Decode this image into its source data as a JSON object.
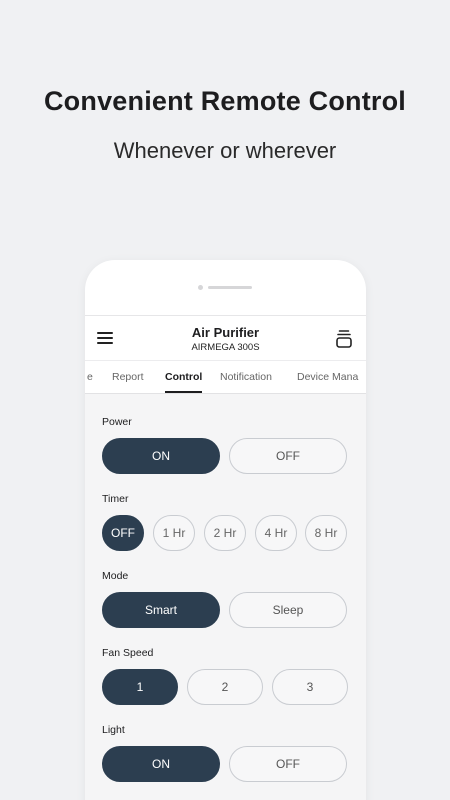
{
  "hero": {
    "title": "Convenient Remote Control",
    "subtitle": "Whenever or wherever"
  },
  "appbar": {
    "title": "Air Purifier",
    "model": "AIRMEGA 300S",
    "menu_icon": "hamburger-menu-icon",
    "device_icon": "device-stack-icon"
  },
  "tabs": [
    {
      "label": "e"
    },
    {
      "label": "Report"
    },
    {
      "label": "Control"
    },
    {
      "label": "Notification"
    },
    {
      "label": "Device Mana"
    }
  ],
  "active_tab": "Control",
  "controls": {
    "power": {
      "label": "Power",
      "options": [
        "ON",
        "OFF"
      ],
      "selected": "ON"
    },
    "timer": {
      "label": "Timer",
      "options": [
        "OFF",
        "1 Hr",
        "2 Hr",
        "4 Hr",
        "8 Hr"
      ],
      "selected": "OFF"
    },
    "mode": {
      "label": "Mode",
      "options": [
        "Smart",
        "Sleep"
      ],
      "selected": "Smart"
    },
    "fan_speed": {
      "label": "Fan Speed",
      "options": [
        "1",
        "2",
        "3"
      ],
      "selected": "1"
    },
    "light": {
      "label": "Light",
      "options": [
        "ON",
        "OFF"
      ],
      "selected": "ON"
    }
  },
  "colors": {
    "background": "#f0f1f3",
    "selected": "#2c3e50",
    "unselected_border": "#c9ccd1"
  }
}
